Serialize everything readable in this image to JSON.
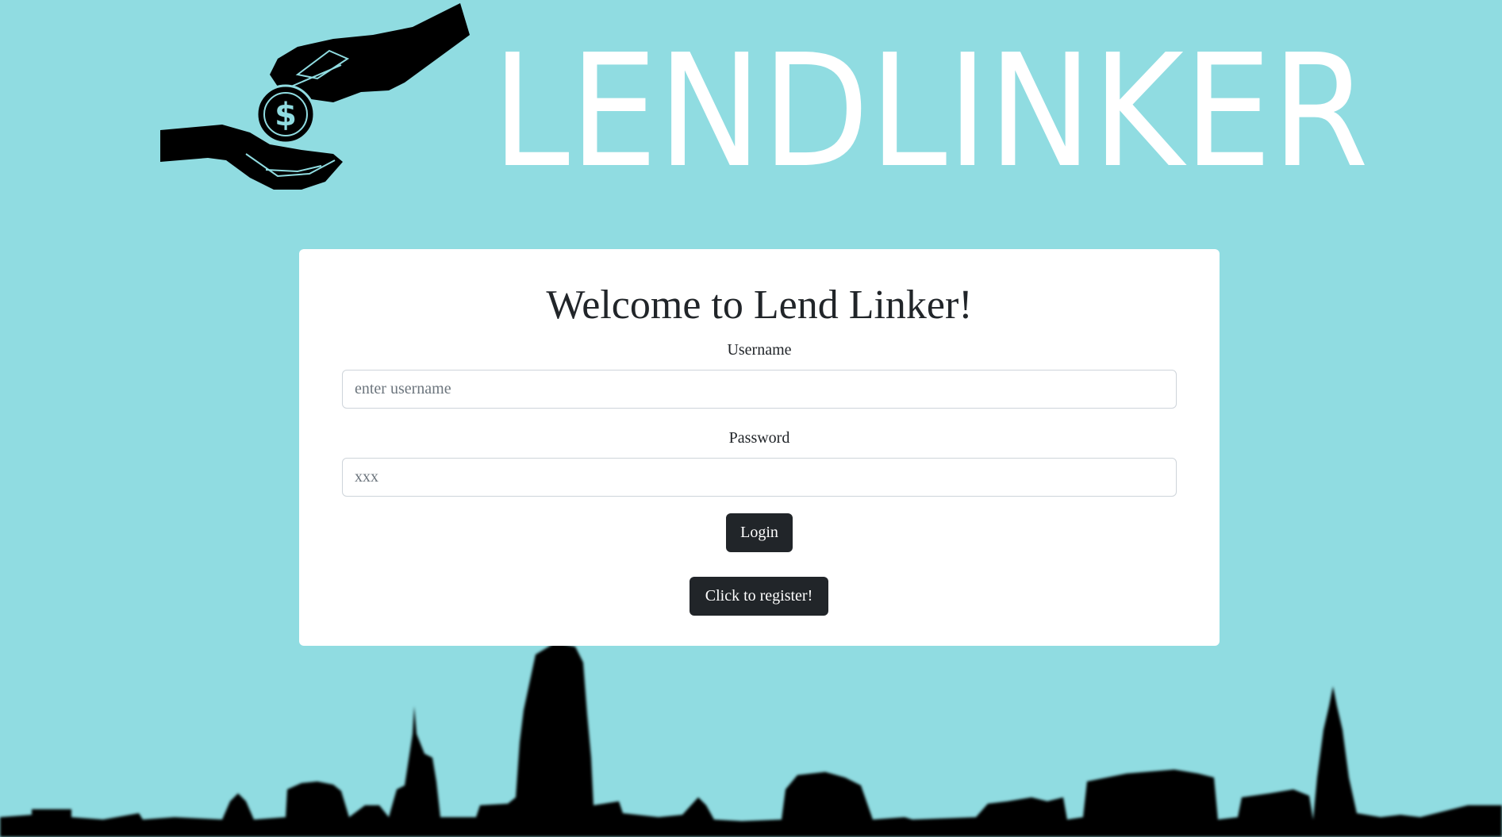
{
  "header": {
    "brand_name": "LENDLINKER",
    "logo_icon": "hand-giving-coin-icon",
    "coin_symbol": "$"
  },
  "login": {
    "title": "Welcome to Lend Linker!",
    "username_label": "Username",
    "username_placeholder": "enter username",
    "username_value": "",
    "password_label": "Password",
    "password_placeholder": "xxx",
    "password_value": "",
    "login_button": "Login",
    "register_button": "Click to register!"
  },
  "colors": {
    "background": "#90dce1",
    "card": "#ffffff",
    "button": "#212529",
    "brand_text": "#ffffff",
    "silhouette": "#000000"
  }
}
